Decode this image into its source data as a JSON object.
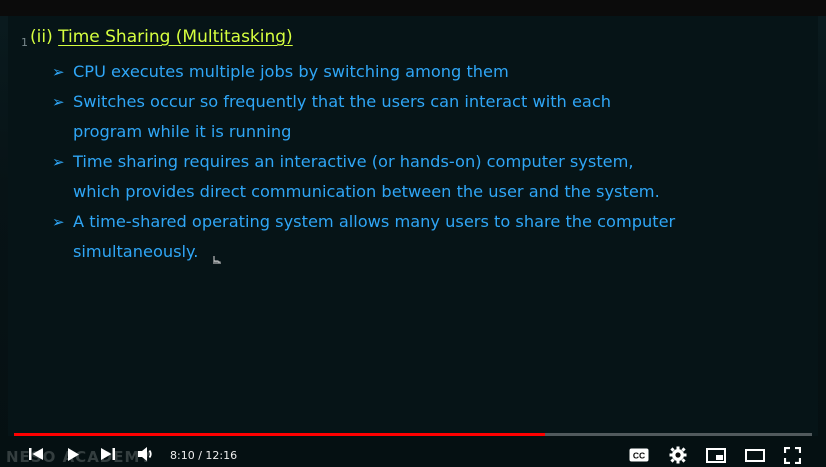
{
  "slide": {
    "number": "1",
    "heading_prefix": "(ii)",
    "heading_title": "Time Sharing (Multitasking)",
    "bullets": [
      {
        "lines": [
          "CPU executes multiple jobs by switching among them"
        ]
      },
      {
        "lines": [
          "Switches occur so frequently that the users can interact with each",
          "program while it is running"
        ]
      },
      {
        "lines": [
          "Time sharing requires an interactive (or hands-on) computer system,",
          "which provides direct communication between the user and the system."
        ]
      },
      {
        "lines": [
          "A time-shared operating system allows many users to share the computer",
          "simultaneously."
        ]
      }
    ],
    "bullet_symbol": "➢"
  },
  "watermark": "NESO ACADEMY",
  "player": {
    "current_time": "8:10",
    "duration": "12:16",
    "time_display": "8:10 / 12:16",
    "progress_fraction": 0.666,
    "progress_color": "#ff0000",
    "icons": [
      "previous-icon",
      "play-icon",
      "next-icon",
      "volume-icon",
      "captions-icon",
      "settings-icon",
      "miniplayer-icon",
      "theater-mode-icon",
      "fullscreen-icon"
    ],
    "captions_label": "CC"
  },
  "colors": {
    "heading": "#d6ff3f",
    "bullet_text": "#2fa6f6",
    "background": "#061417"
  }
}
